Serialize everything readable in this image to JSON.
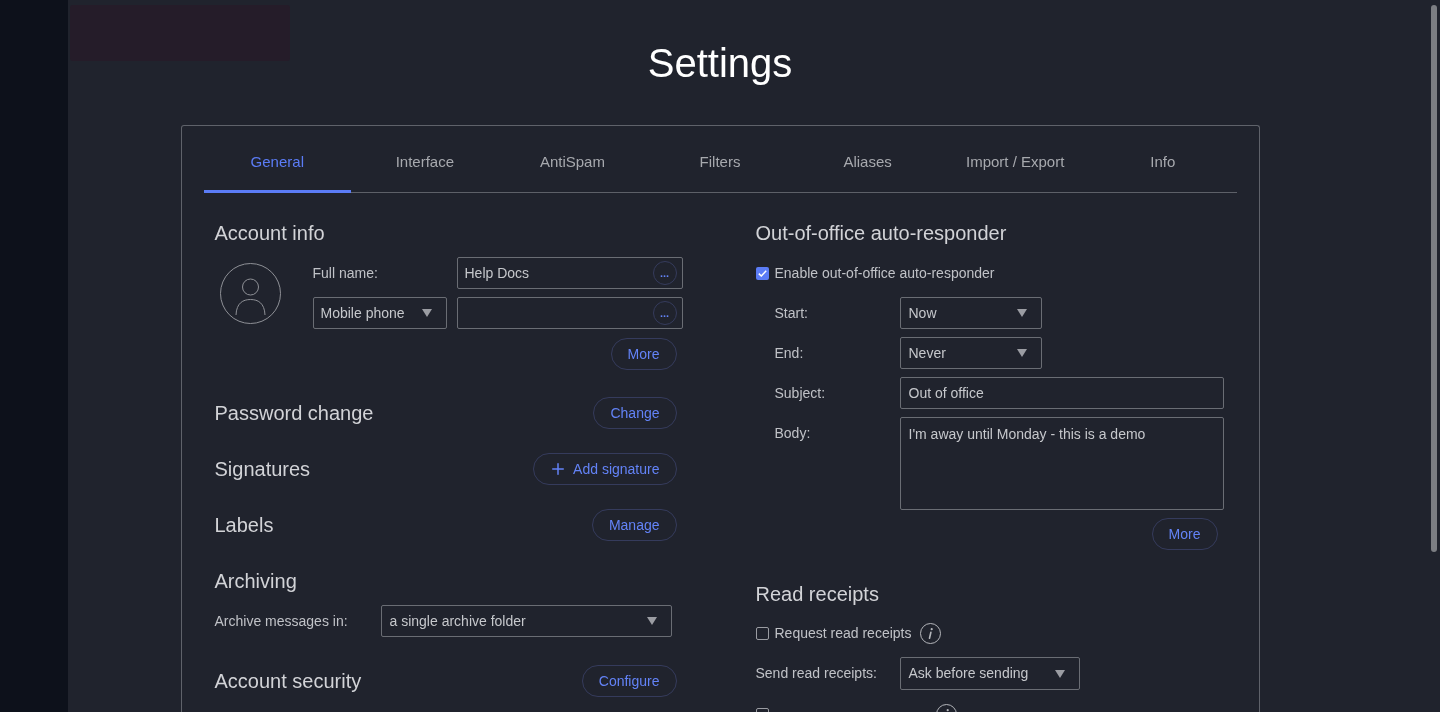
{
  "title": "Settings",
  "tabs": [
    {
      "label": "General",
      "selected": true
    },
    {
      "label": "Interface",
      "selected": false
    },
    {
      "label": "AntiSpam",
      "selected": false
    },
    {
      "label": "Filters",
      "selected": false
    },
    {
      "label": "Aliases",
      "selected": false
    },
    {
      "label": "Import / Export",
      "selected": false
    },
    {
      "label": "Info",
      "selected": false
    }
  ],
  "account_info": {
    "heading": "Account info",
    "full_name": {
      "label": "Full name:",
      "value": "Help Docs",
      "button": "..."
    },
    "phone": {
      "type": "Mobile phone",
      "button": "..."
    },
    "more_button": "More"
  },
  "sections": [
    {
      "kind": "button",
      "heading": "Password change",
      "button": "Change"
    },
    {
      "kind": "add",
      "heading": "Signatures",
      "button": "Add signature"
    },
    {
      "kind": "button",
      "heading": "Labels",
      "button": "Manage"
    },
    {
      "kind": "select",
      "heading": "Archiving",
      "label": "Archive messages in:",
      "value": "a single archive folder"
    },
    {
      "kind": "button",
      "heading": "Account security",
      "button": "Configure"
    }
  ],
  "auto_responder": {
    "heading": "Out-of-office auto-responder",
    "enable": {
      "label": "Enable out-of-office auto-responder",
      "checked": true
    },
    "fields": [
      {
        "kind": "select",
        "label": "Start:",
        "value": "Now"
      },
      {
        "kind": "select",
        "label": "End:",
        "value": "Never"
      },
      {
        "kind": "text",
        "label": "Subject:",
        "value": "Out of office"
      },
      {
        "kind": "textarea",
        "label": "Body:",
        "value": "I'm away until Monday - this is a demo"
      }
    ],
    "more_button": "More"
  },
  "read_receipts": {
    "heading": "Read receipts",
    "request": {
      "label": "Request read receipts",
      "checked": false
    },
    "send": {
      "label": "Send read receipts:",
      "value": "Ask before sending"
    },
    "delivery": {
      "checked": false
    }
  }
}
